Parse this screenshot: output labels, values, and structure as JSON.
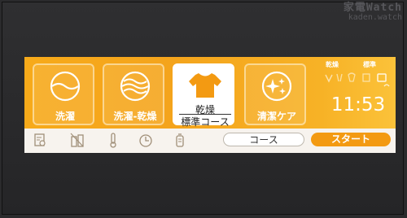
{
  "watermark": {
    "line1": "家電Watch",
    "line2": "kaden.watch"
  },
  "modes": [
    {
      "id": "wash",
      "label": "洗濯",
      "icon": "wash-icon"
    },
    {
      "id": "wash-dry",
      "label": "洗濯-乾燥",
      "icon": "wash-dry-icon"
    },
    {
      "id": "dry",
      "label_line1": "乾燥",
      "label_line2": "標準コース",
      "icon": "shirt-icon",
      "selected": true
    },
    {
      "id": "clean-care",
      "label": "清潔ケア",
      "icon": "sparkle-icon"
    }
  ],
  "status": {
    "dry_label": "乾燥",
    "standard_label": "標準"
  },
  "clock": "11:53",
  "bottom_icons": [
    "settings-icon",
    "detergent-icon",
    "temperature-icon",
    "timer-icon",
    "lock-icon"
  ],
  "course_button": "コース",
  "start_button": "スタート",
  "colors": {
    "accent": "#f7aa1a",
    "start": "#f39a12",
    "panel_bg": "#f7f3ee"
  }
}
